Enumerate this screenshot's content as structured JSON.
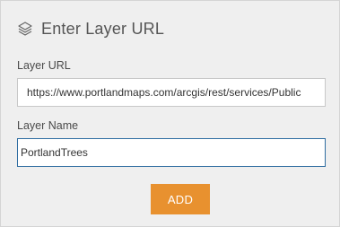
{
  "header": {
    "icon": "layers-icon",
    "title": "Enter Layer URL"
  },
  "form": {
    "url_label": "Layer URL",
    "url_value": "https://www.portlandmaps.com/arcgis/rest/services/Public",
    "name_label": "Layer Name",
    "name_value": "PortlandTrees"
  },
  "actions": {
    "add_label": "ADD"
  },
  "colors": {
    "panel_background": "#efefef",
    "accent_button": "#e8912f",
    "focus_border": "#2f6da1"
  }
}
